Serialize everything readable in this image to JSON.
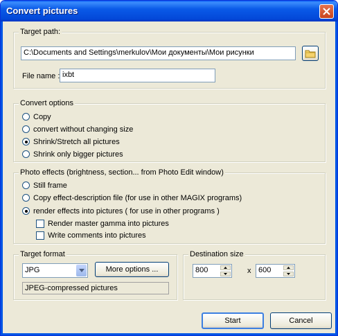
{
  "window": {
    "title": "Convert pictures"
  },
  "target_path": {
    "legend": "Target path:",
    "path_value": "C:\\Documents and Settings\\merkulov\\Мои документы\\Мои рисунки",
    "file_name_label": "File name :",
    "file_name_value": "ixbt"
  },
  "convert_options": {
    "legend": "Convert options",
    "options": [
      {
        "label": "Copy",
        "selected": false
      },
      {
        "label": "convert without changing size",
        "selected": false
      },
      {
        "label": "Shrink/Stretch all pictures",
        "selected": true
      },
      {
        "label": "Shrink only bigger pictures",
        "selected": false
      }
    ]
  },
  "photo_effects": {
    "legend": "Photo effects (brightness, section... from Photo Edit window)",
    "options": [
      {
        "label": "Still frame",
        "selected": false
      },
      {
        "label": "Copy effect-description file (for use in other MAGIX programs)",
        "selected": false
      },
      {
        "label": "render effects into pictures ( for use in other programs )",
        "selected": true
      }
    ],
    "checkboxes": [
      {
        "label": "Render master gamma into pictures",
        "checked": false
      },
      {
        "label": "Write comments into pictures",
        "checked": false
      }
    ]
  },
  "target_format": {
    "legend": "Target format",
    "format_value": "JPG",
    "more_options_label": "More options ...",
    "description": "JPEG-compressed pictures"
  },
  "destination_size": {
    "legend": "Destination size",
    "width": "800",
    "separator": "x",
    "height": "600"
  },
  "buttons": {
    "start": "Start",
    "cancel": "Cancel"
  }
}
